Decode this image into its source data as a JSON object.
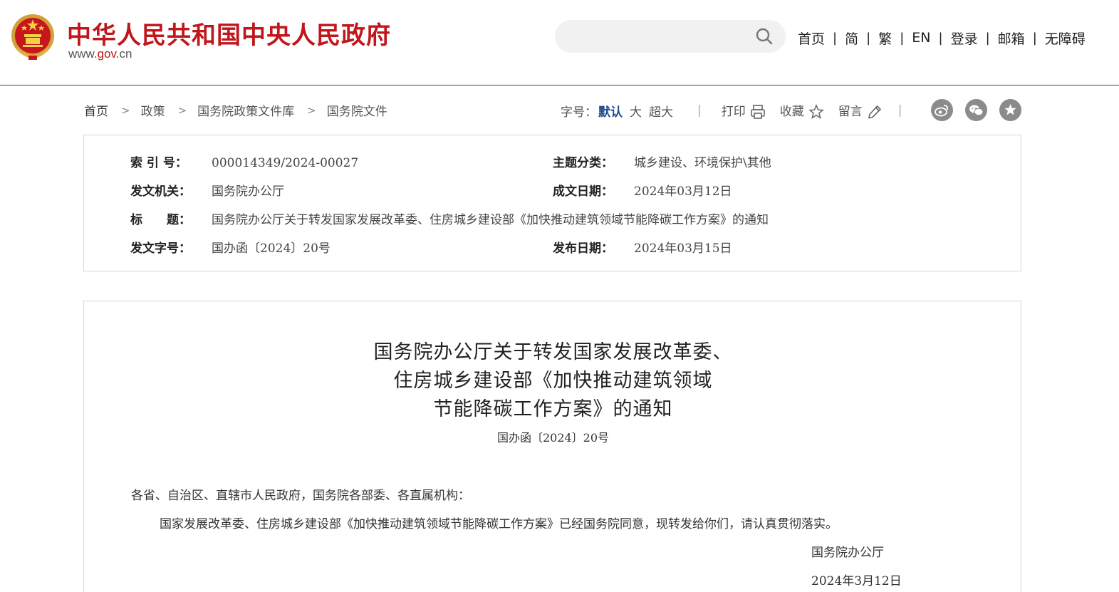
{
  "header": {
    "site_title": "中华人民共和国中央人民政府",
    "site_url_prefix": "www.",
    "site_url_domain": "gov",
    "site_url_suffix": ".cn",
    "search": {
      "placeholder": "",
      "icon": "search-icon"
    },
    "nav": [
      "首页",
      "简",
      "繁",
      "EN",
      "登录",
      "邮箱",
      "无障碍"
    ],
    "nav_separator": "|",
    "brand_color": "#c0161c"
  },
  "breadcrumb": {
    "items": [
      "首页",
      "政策",
      "国务院政策文件库",
      "国务院文件"
    ],
    "separator": ">"
  },
  "tools": {
    "font_size_label": "字号：",
    "font_default": "默认",
    "font_large": "大",
    "font_xlarge": "超大",
    "separator": "|",
    "print": "打印",
    "favorite": "收藏",
    "comment": "留言",
    "icons": [
      "printer-icon",
      "star-icon",
      "pencil-icon"
    ],
    "social_icons": [
      "weibo-icon",
      "wechat-icon",
      "favorite-star-icon"
    ]
  },
  "info": {
    "index_label": "索 引 号：",
    "index_value": "000014349/2024-00027",
    "topic_label": "主题分类：",
    "topic_value": "城乡建设、环境保护\\其他",
    "issuer_label": "发文机关：",
    "issuer_value": "国务院办公厅",
    "written_label": "成文日期：",
    "written_value": "2024年03月12日",
    "title_label": "标　　题：",
    "title_value": "国务院办公厅关于转发国家发展改革委、住房城乡建设部《加快推动建筑领域节能降碳工作方案》的通知",
    "docnum_label": "发文字号：",
    "docnum_value": "国办函〔2024〕20号",
    "published_label": "发布日期：",
    "published_value": "2024年03月15日"
  },
  "document": {
    "title_lines": [
      "国务院办公厅关于转发国家发展改革委、",
      "住房城乡建设部《加快推动建筑领域",
      "节能降碳工作方案》的通知"
    ],
    "doc_number": "国办函〔2024〕20号",
    "salutation": "各省、自治区、直辖市人民政府，国务院各部委、各直属机构：",
    "body": "国家发展改革委、住房城乡建设部《加快推动建筑领域节能降碳工作方案》已经国务院同意，现转发给你们，请认真贯彻落实。",
    "signature": "国务院办公厅",
    "date": "2024年3月12日"
  }
}
